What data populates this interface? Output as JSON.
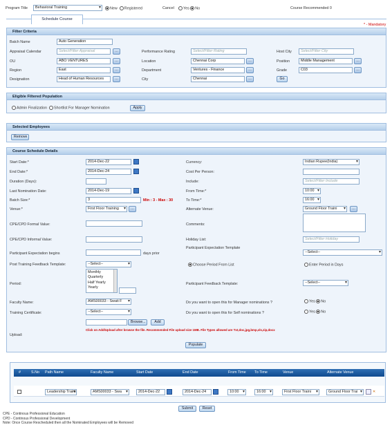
{
  "top": {
    "program_title_label": "Program Title",
    "program_title_value": "Behavioral Training",
    "new_label": "New",
    "registered_label": "Registered",
    "cancel_label": "Cancel",
    "yes_label": "Yes",
    "no_label": "No",
    "course_recommended": "Course Recommended 0",
    "tab_label": "Schedule Course",
    "mandatory": "* - Mandatory"
  },
  "filter": {
    "title": "Filter Criteria",
    "batch_name_label": "Batch Name",
    "batch_name_value": "Auto Generation",
    "appraisal_calendar_label": "Appraisal Calendar",
    "appraisal_calendar_placeholder": "Select/Filter Appraisal",
    "performance_rating_label": "Performance Rating",
    "performance_rating_placeholder": "Select/Filter Rating",
    "host_city_label": "Host City",
    "host_city_placeholder": "Select/Filter City",
    "ou_label": "OU",
    "ou_value": "ABO VENTURES",
    "location_label": "Location",
    "location_value": "Chennai Corp",
    "position_label": "Position",
    "position_value": "Middle Management",
    "region_label": "Region",
    "region_value": "East",
    "department_label": "Department",
    "department_value": "Ventures - Finance",
    "grade_label": "Grade",
    "grade_value": "C03",
    "designation_label": "Designation",
    "designation_value": "Head of Human Resources",
    "city_label": "City",
    "city_value": "Chennai",
    "go_label": "Go"
  },
  "eligible": {
    "title": "Eligible Filtered Population",
    "admin_finalization": "Admin Finalization",
    "shortlist_manager": "Shortlist For Manager Nomination",
    "apply_label": "Apply"
  },
  "selected": {
    "title": "Selected Employees",
    "remove_label": "Remove"
  },
  "schedule": {
    "title": "Course Schedule Details",
    "start_date_label": "Start Date:*",
    "start_date_value": "2014-Dec-22",
    "currency_label": "Currency:",
    "currency_value": "Indian Rupee(India)",
    "end_date_label": "End Date:*",
    "end_date_value": "2014-Dec-24",
    "cost_per_person_label": "Cost Per Person:",
    "duration_label": "Duration (Days):",
    "include_label": "Include:",
    "include_placeholder": "Select/Filter Include",
    "last_nomination_label": "Last Nomination Date:",
    "last_nomination_value": "2014-Dec-19",
    "from_time_label": "From Time:*",
    "from_time_value": "10:00",
    "batch_size_label": "Batch Size:*",
    "batch_size_value": "3",
    "batch_size_hint": "Min : 3 - Max : 30",
    "to_time_label": "To Time:*",
    "to_time_value": "16:00",
    "venue_label": "Venue:*",
    "venue_value": "First Floor Training",
    "alternate_venue_label": "Alternate Venue:",
    "alternate_venue_value": "Ground Floor Traini",
    "cpe_formal_label": "CPE/CPD Formal Value:",
    "comments_label": "Comments:",
    "cpe_informal_label": "CPE/CPD Informal Value:",
    "holiday_list_label": "Holiday List:",
    "holiday_list_placeholder": "Select/Filter Holiday",
    "participant_expectation_begins_label": "Participant Expectation begins",
    "days_prior_label": "days prior",
    "participant_expectation_template_label": "Participant Expectation Template",
    "select_placeholder": "--Select--",
    "post_training_label": "Post Training Feedback Template:",
    "choose_period_label": "Choose Period From List",
    "enter_period_label": "Enter Period in Days",
    "period_label": "Period:",
    "period_options": [
      "Monthly",
      "Quarterly",
      "Half Yearly",
      "Yearly"
    ],
    "participant_feedback_label": "Participant Feedback Template:",
    "faculty_name_label": "Faculty Name:",
    "faculty_name_value": "AMS00033 - Swati F",
    "manager_nominations_label": "Do you want to open this for Manager nominations ?",
    "training_certificate_label": "Training Certificate:",
    "self_nominations_label": "Do you want to open this for Self nominations ?",
    "yes_label": "Yes",
    "no_label": "No",
    "upload_label": "Upload:",
    "browse_label": "Browse...",
    "add_label": "Add",
    "upload_hint": "Click on Add/Upload after browse the file. Recommended File upload size 1MB. File Types allowed are Txt,doc,jpg,bmp,xls,zip,docx",
    "populate_label": "Populate"
  },
  "grid": {
    "headers": [
      "#",
      "S.No",
      "Path Name",
      "Faculty Name",
      "Start Date",
      "End Date",
      "From Time",
      "To Time",
      "Venue",
      "Alternate Venue"
    ],
    "row": {
      "path_name": "Leadership Trainin",
      "faculty_name": "AMS00033 - Swa",
      "start_date": "2014-Dec-22",
      "end_date": "2014-Dec-24",
      "from_time": "10:00",
      "to_time": "16:00",
      "venue": "First Floor Traini",
      "alternate_venue": "Ground Floor Trai"
    }
  },
  "footer": {
    "submit_label": "Submit",
    "reset_label": "Reset",
    "note1": "CPE - Continous Professional Education",
    "note2": "CPD - Continous Professional Development",
    "note3": "Note: Once Course Rescheduled then all the Nominated Employees will be Removed"
  }
}
